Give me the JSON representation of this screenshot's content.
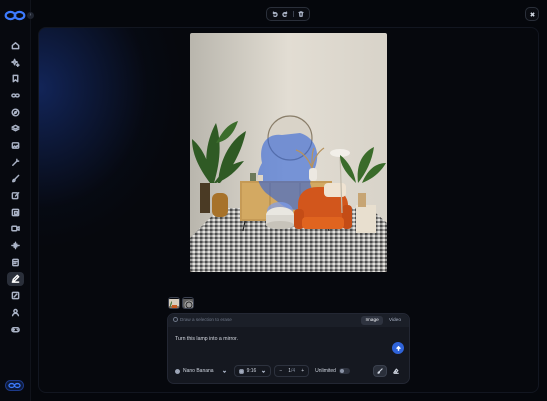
{
  "sidebar": {
    "collapse_glyph": "›",
    "items": [
      {
        "icon": "home-icon",
        "active": false
      },
      {
        "icon": "sparkles-icon",
        "active": false
      },
      {
        "icon": "bookmark-icon",
        "active": false
      },
      {
        "icon": "infinity-icon",
        "active": false
      },
      {
        "icon": "compass-icon",
        "active": false
      },
      {
        "icon": "layers-icon",
        "active": false
      },
      {
        "icon": "image-icon",
        "active": false
      },
      {
        "icon": "magic-wand-icon",
        "active": false
      },
      {
        "icon": "brush-icon",
        "active": false
      },
      {
        "icon": "edit-icon",
        "active": false
      },
      {
        "icon": "crop-icon",
        "active": false
      },
      {
        "icon": "video-icon",
        "active": false
      },
      {
        "icon": "audio-wave-icon",
        "active": false
      },
      {
        "icon": "document-icon",
        "active": false
      },
      {
        "icon": "pen-edit-icon",
        "active": true
      },
      {
        "icon": "image-edit-icon",
        "active": false
      },
      {
        "icon": "users-icon",
        "active": false
      },
      {
        "icon": "gamepad-icon",
        "active": false
      }
    ]
  },
  "toolbar": {
    "icons": [
      "undo-icon",
      "redo-icon",
      "trash-icon"
    ],
    "close_icon": "close-icon"
  },
  "prompt": {
    "hint": "Draw a selection to erase",
    "modes": [
      "Image",
      "Video"
    ],
    "active_mode": "Image",
    "text": "Turn this lamp into a mirror."
  },
  "controls": {
    "model": "Nano Banana",
    "aspect_ratio": "9:16",
    "count": "1",
    "count_total": "/4",
    "unlimited_label": "Unlimited"
  },
  "colors": {
    "accent": "#2f63d9",
    "background": "#05070c"
  }
}
